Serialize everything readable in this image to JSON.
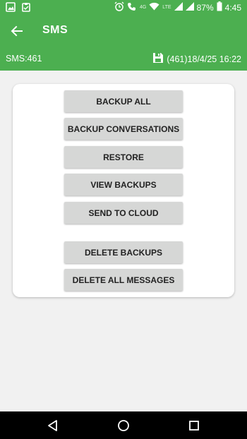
{
  "status_bar": {
    "battery_percent": "87%",
    "time": "4:45",
    "network_label": "LTE",
    "network_type": "4G",
    "left_icons": [
      "image-icon",
      "clipboard-icon"
    ],
    "right_icons": [
      "alarm-icon",
      "wifi-call-icon",
      "wifi-icon",
      "signal-icon",
      "battery-icon"
    ]
  },
  "app_bar": {
    "title": "SMS"
  },
  "info_bar": {
    "sms_count": "SMS:461",
    "last_backup": "(461)18/4/25 16:22"
  },
  "actions": {
    "backup_all": "BACKUP ALL",
    "backup_conversations": "BACKUP CONVERSATIONS",
    "restore": "RESTORE",
    "view_backups": "VIEW BACKUPS",
    "send_to_cloud": "SEND TO CLOUD",
    "delete_backups": "DELETE BACKUPS",
    "delete_all_messages": "DELETE ALL MESSAGES"
  },
  "colors": {
    "accent": "#4caf50",
    "button_bg": "#d6d7d6",
    "background": "#f1f1f1"
  }
}
